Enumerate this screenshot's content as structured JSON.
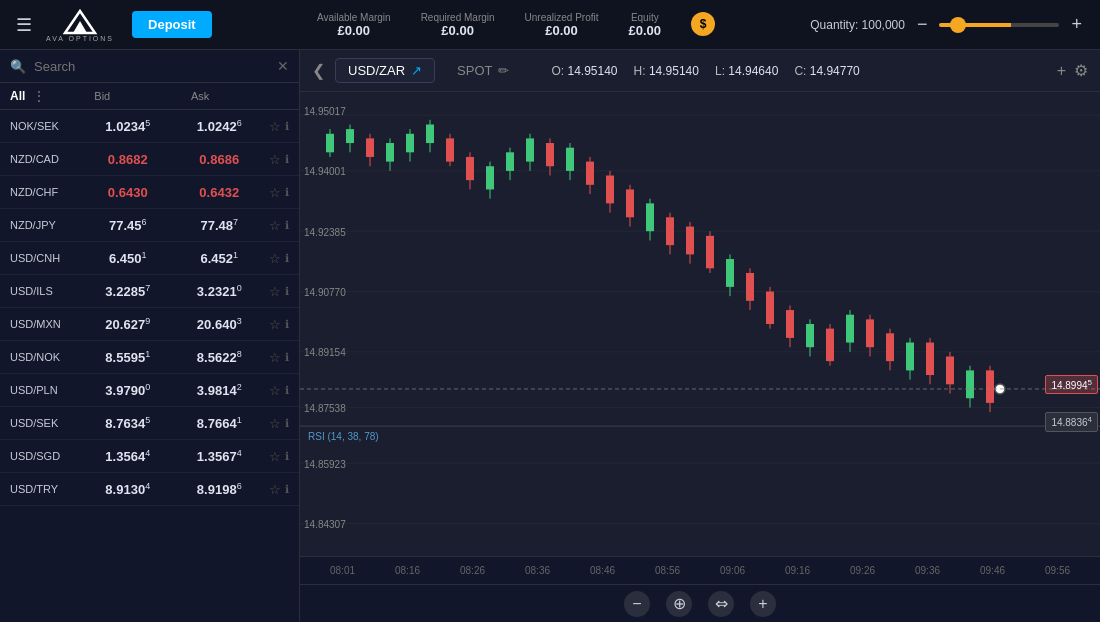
{
  "topbar": {
    "hamburger": "☰",
    "logo_text": "AVA",
    "logo_sub": "AVA OPTIONS",
    "deposit_label": "Deposit",
    "available_margin_label": "Available Margin",
    "available_margin_value": "£0.00",
    "required_margin_label": "Required Margin",
    "required_margin_value": "£0.00",
    "unrealized_profit_label": "Unrealized Profit",
    "unrealized_profit_value": "£0.00",
    "equity_label": "Equity",
    "equity_value": "£0.00",
    "equity_icon": "$",
    "quantity_label": "Quantity: 100,000",
    "qty_minus": "−",
    "qty_plus": "+"
  },
  "sidebar": {
    "search_placeholder": "Search",
    "all_label": "All",
    "col_bid": "Bid",
    "col_ask": "Ask",
    "instruments": [
      {
        "name": "NOK/SEK",
        "bid_main": "1.0234",
        "bid_sup": "5",
        "ask_main": "1.0242",
        "ask_sup": "6",
        "bid_color": "neutral",
        "ask_color": "neutral"
      },
      {
        "name": "NZD/CAD",
        "bid_main": "0.8682",
        "bid_sup": "",
        "ask_main": "0.8686",
        "ask_sup": "",
        "bid_color": "red",
        "ask_color": "red"
      },
      {
        "name": "NZD/CHF",
        "bid_main": "0.6430",
        "bid_sup": "",
        "ask_main": "0.6432",
        "ask_sup": "",
        "bid_color": "red",
        "ask_color": "red"
      },
      {
        "name": "NZD/JPY",
        "bid_main": "77.45",
        "bid_sup": "6",
        "ask_main": "77.48",
        "ask_sup": "7",
        "bid_color": "neutral",
        "ask_color": "neutral"
      },
      {
        "name": "USD/CNH",
        "bid_main": "6.450",
        "bid_sup": "1",
        "ask_main": "6.452",
        "ask_sup": "1",
        "bid_color": "neutral",
        "ask_color": "neutral"
      },
      {
        "name": "USD/ILS",
        "bid_main": "3.2285",
        "bid_sup": "7",
        "ask_main": "3.2321",
        "ask_sup": "0",
        "bid_color": "neutral",
        "ask_color": "neutral"
      },
      {
        "name": "USD/MXN",
        "bid_main": "20.627",
        "bid_sup": "9",
        "ask_main": "20.640",
        "ask_sup": "3",
        "bid_color": "neutral",
        "ask_color": "neutral"
      },
      {
        "name": "USD/NOK",
        "bid_main": "8.5595",
        "bid_sup": "1",
        "ask_main": "8.5622",
        "ask_sup": "8",
        "bid_color": "neutral",
        "ask_color": "neutral"
      },
      {
        "name": "USD/PLN",
        "bid_main": "3.9790",
        "bid_sup": "0",
        "ask_main": "3.9814",
        "ask_sup": "2",
        "bid_color": "neutral",
        "ask_color": "neutral"
      },
      {
        "name": "USD/SEK",
        "bid_main": "8.7634",
        "bid_sup": "5",
        "ask_main": "8.7664",
        "ask_sup": "1",
        "bid_color": "neutral",
        "ask_color": "neutral"
      },
      {
        "name": "USD/SGD",
        "bid_main": "1.3564",
        "bid_sup": "4",
        "ask_main": "1.3567",
        "ask_sup": "4",
        "bid_color": "neutral",
        "ask_color": "neutral"
      },
      {
        "name": "USD/TRY",
        "bid_main": "8.9130",
        "bid_sup": "4",
        "ask_main": "8.9198",
        "ask_sup": "6",
        "bid_color": "neutral",
        "ask_color": "neutral"
      }
    ]
  },
  "chart": {
    "collapse_icon": "❮",
    "tab1_label": "USD/ZAR",
    "tab1_icon": "↗",
    "tab2_label": "SPOT",
    "tab2_icon": "✏",
    "ohlc_o_label": "O:",
    "ohlc_o_value": "14.95140",
    "ohlc_h_label": "H:",
    "ohlc_h_value": "14.95140",
    "ohlc_l_label": "L:",
    "ohlc_l_value": "14.94640",
    "ohlc_c_label": "C:",
    "ohlc_c_value": "14.94770",
    "add_icon": "+",
    "settings_icon": "⚙",
    "price_levels": [
      "14.95017",
      "14.94001",
      "14.92385",
      "14.90770",
      "14.89154",
      "14.87538",
      "14.85923",
      "14.84307"
    ],
    "time_labels": [
      "08:01",
      "08:16",
      "08:26",
      "08:36",
      "08:46",
      "08:56",
      "09:06",
      "09:16",
      "09:26",
      "09:36",
      "09:46",
      "09:56"
    ],
    "current_price_top": "14.8994",
    "current_price_sup_top": "5",
    "current_price_bottom": "14.8836",
    "current_price_sup_bottom": "4",
    "rsi_label": "RSI (14, 38, 78)",
    "ctrl_minus": "−",
    "ctrl_cross": "⊕",
    "ctrl_arrows": "⇔",
    "ctrl_plus": "+"
  }
}
